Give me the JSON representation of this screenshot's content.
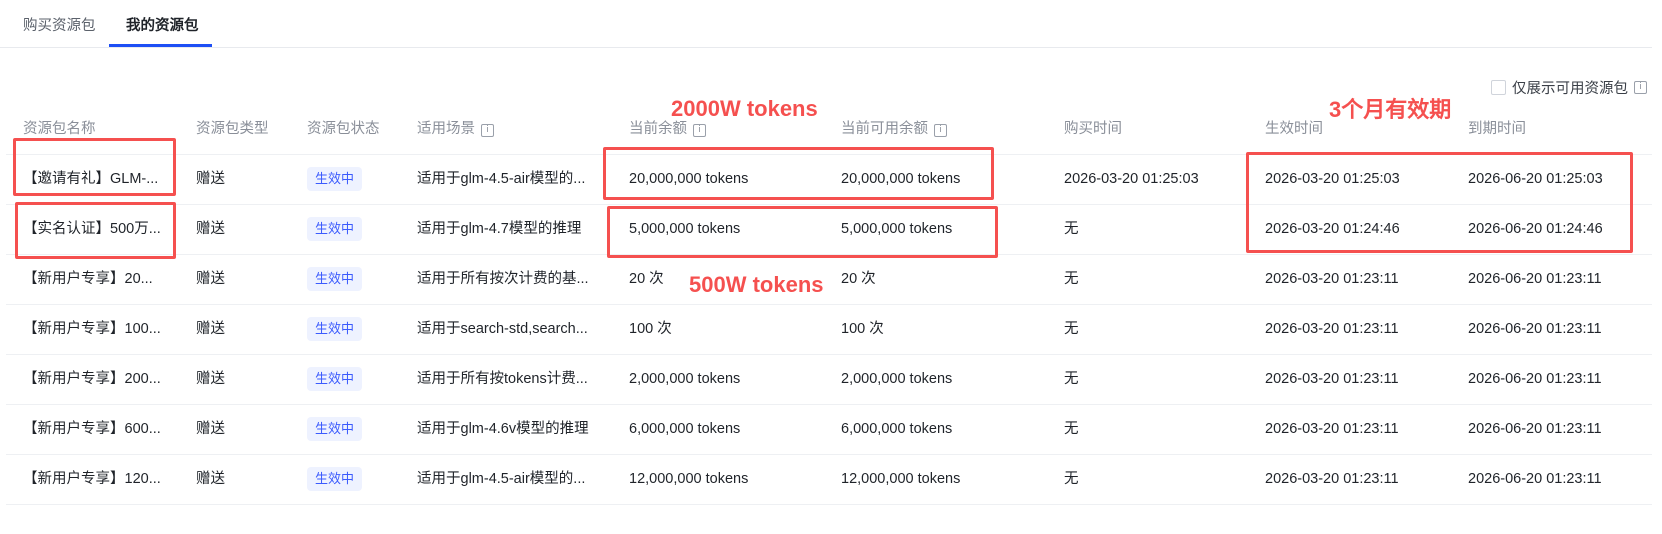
{
  "tabs": [
    {
      "label": "购买资源包",
      "active": false
    },
    {
      "label": "我的资源包",
      "active": true
    }
  ],
  "filter": {
    "label": "仅展示可用资源包",
    "checked": false,
    "info_icon": "i"
  },
  "columns": [
    "资源包名称",
    "资源包类型",
    "资源包状态",
    "适用场景",
    "当前余额",
    "当前可用余额",
    "购买时间",
    "生效时间",
    "到期时间"
  ],
  "info_icon": "i",
  "rows": [
    [
      "【邀请有礼】GLM-...",
      "赠送",
      "生效中",
      "适用于glm-4.5-air模型的...",
      "20,000,000 tokens",
      "20,000,000 tokens",
      "2026-03-20 01:25:03",
      "2026-03-20 01:25:03",
      "2026-06-20 01:25:03"
    ],
    [
      "【实名认证】500万...",
      "赠送",
      "生效中",
      "适用于glm-4.7模型的推理",
      "5,000,000 tokens",
      "5,000,000 tokens",
      "无",
      "2026-03-20 01:24:46",
      "2026-06-20 01:24:46"
    ],
    [
      "【新用户专享】20...",
      "赠送",
      "生效中",
      "适用于所有按次计费的基...",
      "20 次",
      "20 次",
      "无",
      "2026-03-20 01:23:11",
      "2026-06-20 01:23:11"
    ],
    [
      "【新用户专享】100...",
      "赠送",
      "生效中",
      "适用于search-std,search...",
      "100 次",
      "100 次",
      "无",
      "2026-03-20 01:23:11",
      "2026-06-20 01:23:11"
    ],
    [
      "【新用户专享】200...",
      "赠送",
      "生效中",
      "适用于所有按tokens计费...",
      "2,000,000 tokens",
      "2,000,000 tokens",
      "无",
      "2026-03-20 01:23:11",
      "2026-06-20 01:23:11"
    ],
    [
      "【新用户专享】600...",
      "赠送",
      "生效中",
      "适用于glm-4.6v模型的推理",
      "6,000,000 tokens",
      "6,000,000 tokens",
      "无",
      "2026-03-20 01:23:11",
      "2026-06-20 01:23:11"
    ],
    [
      "【新用户专享】120...",
      "赠送",
      "生效中",
      "适用于glm-4.5-air模型的...",
      "12,000,000 tokens",
      "12,000,000 tokens",
      "无",
      "2026-03-20 01:23:11",
      "2026-06-20 01:23:11"
    ]
  ],
  "annotations": {
    "color": "#f5504f",
    "labels": [
      "2000W tokens",
      "500W tokens",
      "3个月有效期"
    ]
  },
  "colors": {
    "accent": "#1d4ff5",
    "badge_bg": "#eef2ff",
    "badge_text": "#3b5bfd"
  }
}
